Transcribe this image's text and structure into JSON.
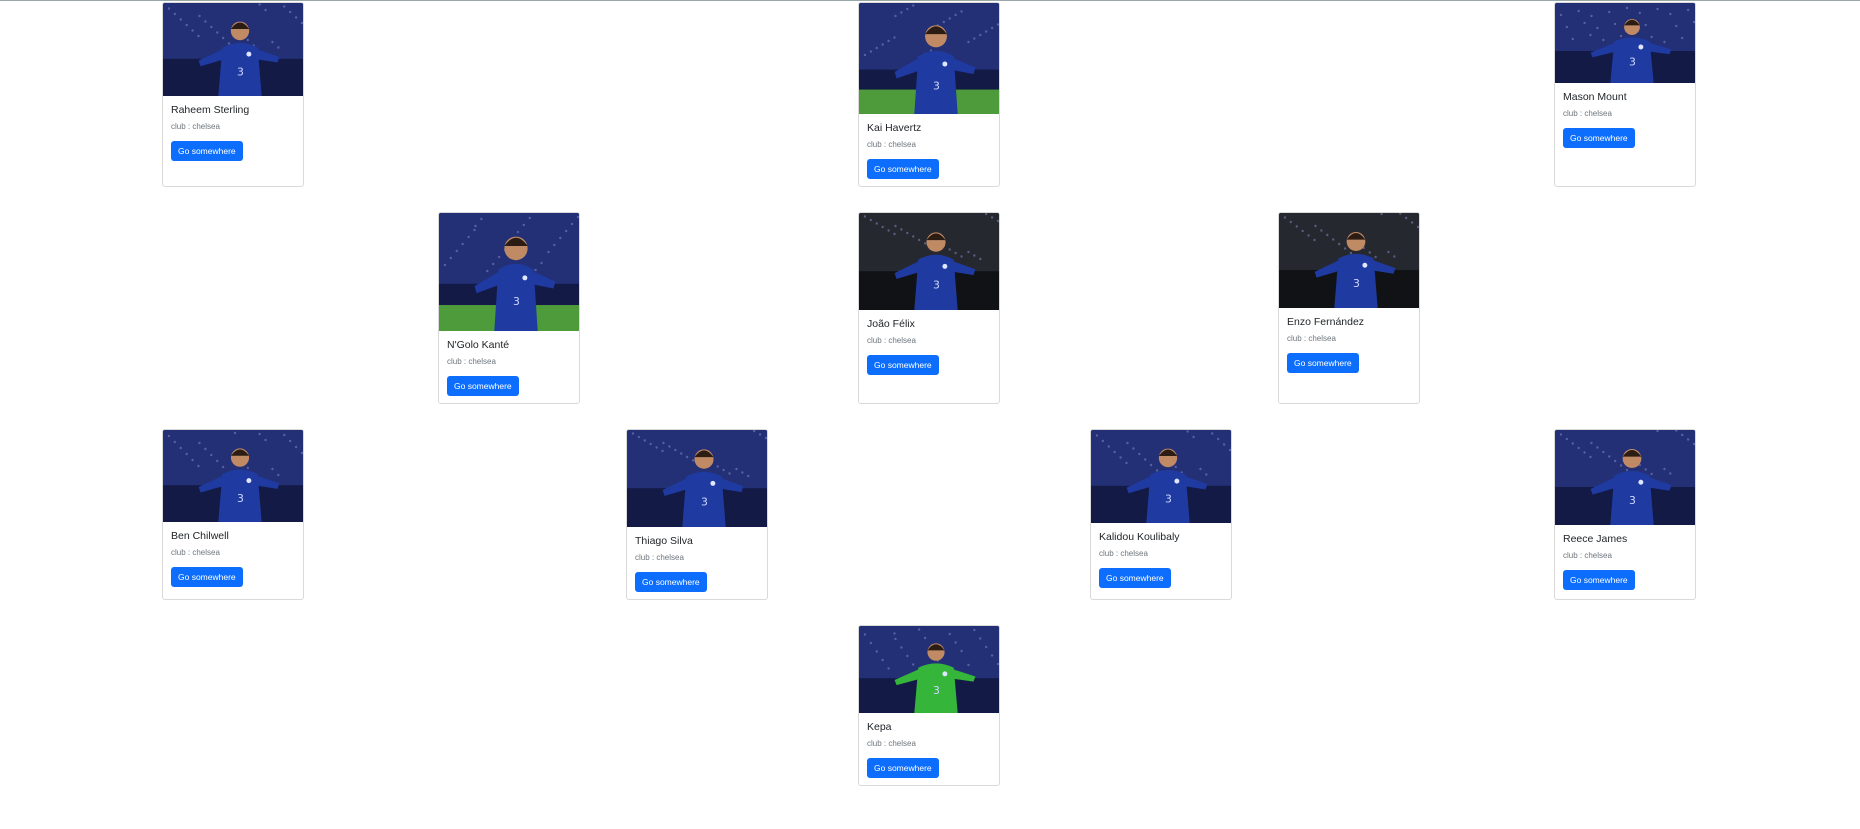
{
  "players": [
    {
      "id": "sterling",
      "name": "Raheem Sterling",
      "club": "club : chelsea",
      "button": "Go somewhere",
      "pitch": "crowd"
    },
    {
      "id": "havertz",
      "name": "Kai Havertz",
      "club": "club : chelsea",
      "button": "Go somewhere",
      "pitch": "grass"
    },
    {
      "id": "mount",
      "name": "Mason Mount",
      "club": "club : chelsea",
      "button": "Go somewhere",
      "pitch": "crowd"
    },
    {
      "id": "kante",
      "name": "N'Golo Kanté",
      "club": "club : chelsea",
      "button": "Go somewhere",
      "pitch": "grass"
    },
    {
      "id": "felix",
      "name": "João Félix",
      "club": "club : chelsea",
      "button": "Go somewhere",
      "pitch": "dark"
    },
    {
      "id": "fernandez",
      "name": "Enzo Fernández",
      "club": "club : chelsea",
      "button": "Go somewhere",
      "pitch": "dark"
    },
    {
      "id": "chilwell",
      "name": "Ben Chilwell",
      "club": "club : chelsea",
      "button": "Go somewhere",
      "pitch": "crowd"
    },
    {
      "id": "silva",
      "name": "Thiago Silva",
      "club": "club : chelsea",
      "button": "Go somewhere",
      "pitch": "crowd"
    },
    {
      "id": "koulibaly",
      "name": "Kalidou Koulibaly",
      "club": "club : chelsea",
      "button": "Go somewhere",
      "pitch": "crowd"
    },
    {
      "id": "james",
      "name": "Reece James",
      "club": "club : chelsea",
      "button": "Go somewhere",
      "pitch": "crowd"
    },
    {
      "id": "kepa",
      "name": "Kepa",
      "club": "club : chelsea",
      "button": "Go somewhere",
      "pitch": "crowd",
      "keeper": true
    }
  ],
  "colors": {
    "button": "#0d6efd",
    "kit": "#1f3aa0",
    "keeper_kit": "#35b53a"
  }
}
